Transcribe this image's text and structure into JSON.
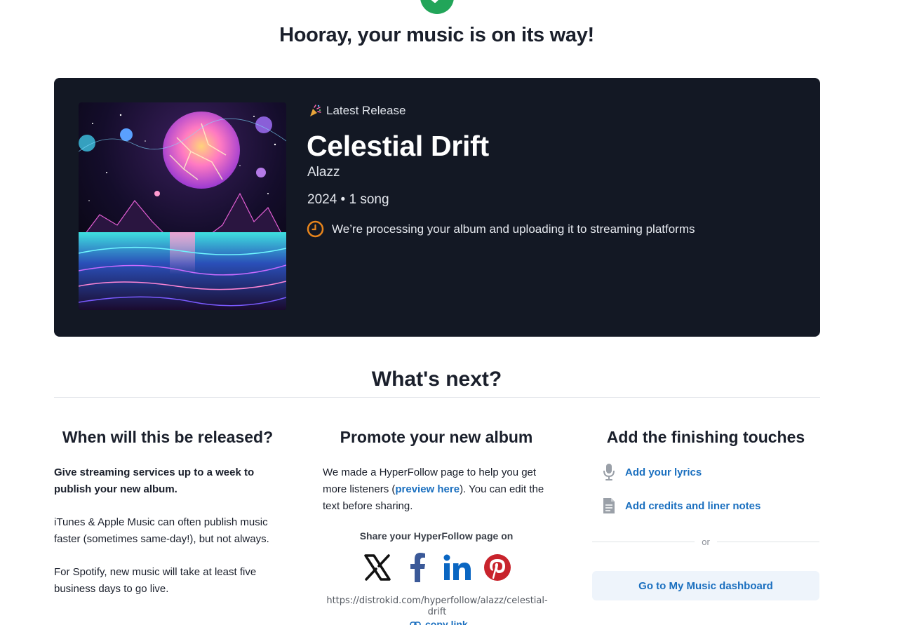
{
  "header": {
    "title": "Hooray, your music is on its way!"
  },
  "release": {
    "badge_label": "Latest Release",
    "album_title": "Celestial Drift",
    "artist": "Alazz",
    "meta": "2024 • 1 song",
    "status": "We’re processing your album and uploading it to streaming platforms"
  },
  "next": {
    "title": "What's next?",
    "when": {
      "title": "When will this be released?",
      "p1": "Give streaming services up to a week to publish your new album.",
      "p2": "iTunes & Apple Music can often publish music faster (sometimes same-day!), but not always.",
      "p3": "For Spotify, new music will take at least five business days to go live."
    },
    "promote": {
      "title": "Promote your new album",
      "text_before": "We made a HyperFollow page to help you get more listeners (",
      "preview_link": "preview here",
      "text_after": "). You can edit the text before sharing.",
      "share_label": "Share your HyperFollow page on",
      "url": "https://distrokid.com/hyperfollow/alazz/celestial-drift",
      "copy_label": "copy link"
    },
    "touches": {
      "title": "Add the finishing touches",
      "lyrics": "Add your lyrics",
      "credits": "Add credits and liner notes",
      "or": "or",
      "dashboard_button": "Go to My Music dashboard"
    }
  },
  "colors": {
    "accent": "#1a6fbf",
    "card_bg": "#131824",
    "success": "#22a559",
    "processing": "#e8851c"
  },
  "icons": [
    "check-icon",
    "party-popper-icon",
    "clock-icon",
    "x-icon",
    "facebook-icon",
    "linkedin-icon",
    "pinterest-icon",
    "microphone-icon",
    "document-icon",
    "link-icon"
  ]
}
